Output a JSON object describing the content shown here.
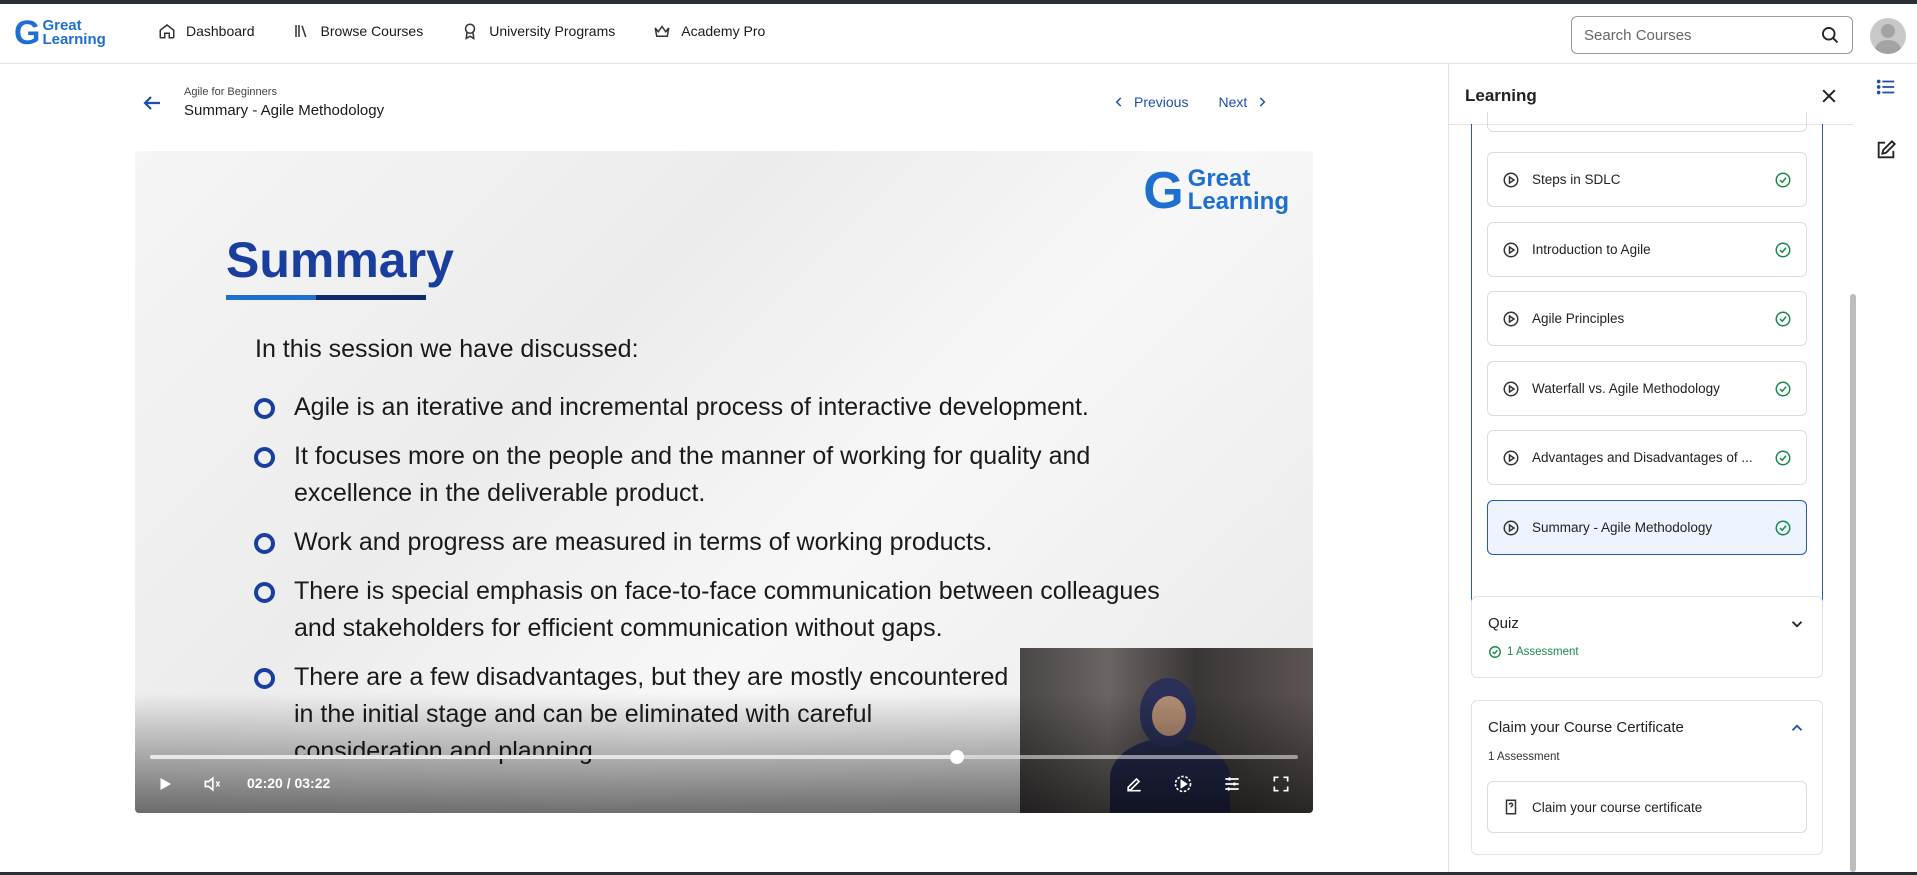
{
  "header": {
    "logo_top": "Great",
    "logo_bottom": "Learning",
    "nav": [
      {
        "label": "Dashboard",
        "icon": "home-icon"
      },
      {
        "label": "Browse Courses",
        "icon": "library-icon"
      },
      {
        "label": "University Programs",
        "icon": "award-icon"
      },
      {
        "label": "Academy Pro",
        "icon": "crown-icon"
      }
    ],
    "search_placeholder": "Search Courses"
  },
  "breadcrumb": {
    "course": "Agile for Beginners",
    "lesson": "Summary - Agile Methodology",
    "previous": "Previous",
    "next": "Next"
  },
  "video": {
    "slide_title": "Summary",
    "slide_intro": "In this session we have discussed:",
    "bullets": [
      "Agile is an iterative and incremental process of interactive development.",
      "It focuses more on the people and the manner of working for quality and excellence in the deliverable product.",
      "Work and progress are measured in terms of working products.",
      "There is special emphasis on face-to-face communication between colleagues and stakeholders for efficient communication without gaps.",
      "There are a few disadvantages, but they are mostly encountered in the initial stage and can be eliminated with careful consideration and planning."
    ],
    "current_time": "02:20",
    "duration": "03:22",
    "time_display": "02:20 / 03:22",
    "progress": 0.703
  },
  "panel": {
    "title": "Learning",
    "lessons": [
      {
        "label": "Steps in SDLC",
        "completed": true
      },
      {
        "label": "Introduction to Agile",
        "completed": true
      },
      {
        "label": "Agile Principles",
        "completed": true
      },
      {
        "label": "Waterfall vs. Agile Methodology",
        "completed": true
      },
      {
        "label": "Advantages and Disadvantages of ...",
        "completed": true
      },
      {
        "label": "Summary - Agile Methodology",
        "completed": true,
        "active": true
      }
    ],
    "quiz": {
      "title": "Quiz",
      "meta": "1 Assessment"
    },
    "certificate": {
      "title": "Claim your Course Certificate",
      "meta": "1 Assessment",
      "item": "Claim your course certificate"
    }
  },
  "colors": {
    "accent": "#1f4fa8",
    "brand": "#1f6fd1",
    "success": "#1a8a4a",
    "slide_title": "#1a3e9e"
  }
}
